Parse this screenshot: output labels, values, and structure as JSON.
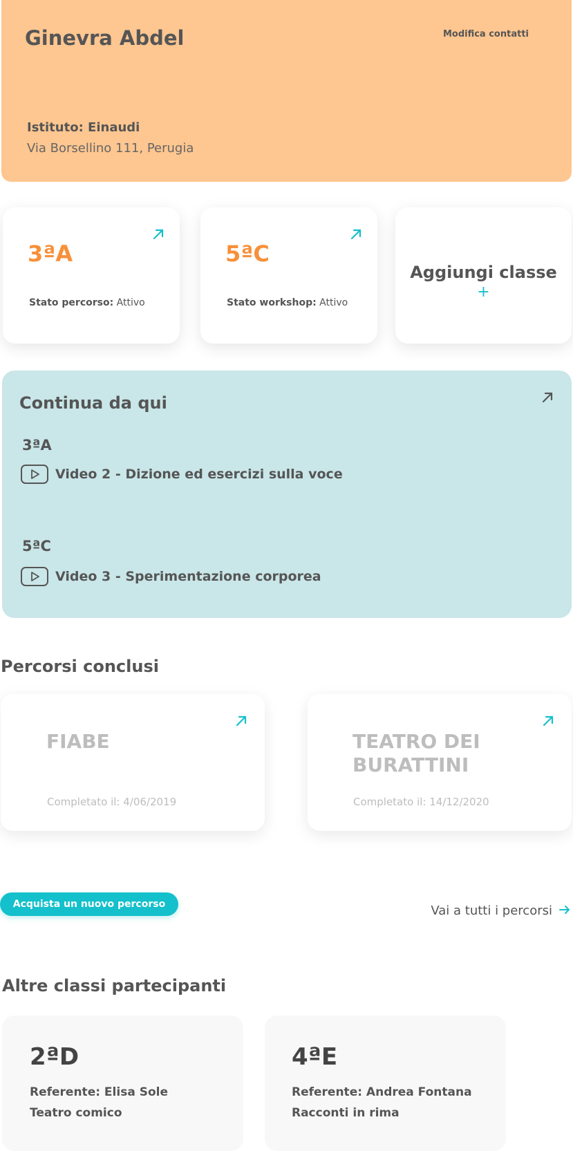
{
  "profile": {
    "name": "Ginevra Abdel",
    "edit_label": "Modifica contatti",
    "school_label": "Istituto: Einaudi",
    "address": "Via Borsellino 111, Perugia"
  },
  "classes": [
    {
      "code": "3ªA",
      "status_label": "Stato percorso:",
      "status_value": "Attivo"
    },
    {
      "code": "5ªC",
      "status_label": "Stato workshop:",
      "status_value": "Attivo"
    }
  ],
  "add_class": {
    "label": "Aggiungi classe",
    "plus": "+"
  },
  "continue": {
    "title": "Continua da qui",
    "items": [
      {
        "class": "3ªA",
        "video": "Video 2 - Dizione ed esercizi sulla voce"
      },
      {
        "class": "5ªC",
        "video": "Video 3 - Sperimentazione corporea"
      }
    ]
  },
  "completed": {
    "title": "Percorsi conclusi",
    "items": [
      {
        "title": "FIABE",
        "date": "Completato il: 4/06/2019"
      },
      {
        "title": "TEATRO DEI BURATTINI",
        "date": "Completato il: 14/12/2020"
      }
    ]
  },
  "actions": {
    "buy_label": "Acquista un nuovo percorso",
    "all_label": "Vai a tutti i percorsi"
  },
  "others": {
    "title": "Altre classi partecipanti",
    "items": [
      {
        "code": "2ªD",
        "referent": "Referente: Elisa Sole",
        "course": "Teatro comico"
      },
      {
        "code": "4ªE",
        "referent": "Referente: Andrea Fontana",
        "course": "Racconti in rima"
      }
    ]
  },
  "colors": {
    "profile_bg": "#fec690",
    "accent_orange": "#f7903a",
    "accent_teal": "#14c0cb",
    "continue_bg": "#c9e6e8"
  },
  "icons": {
    "open_arrow": "arrow-up-right-icon",
    "play": "play-icon",
    "right_arrow": "arrow-right-icon"
  }
}
